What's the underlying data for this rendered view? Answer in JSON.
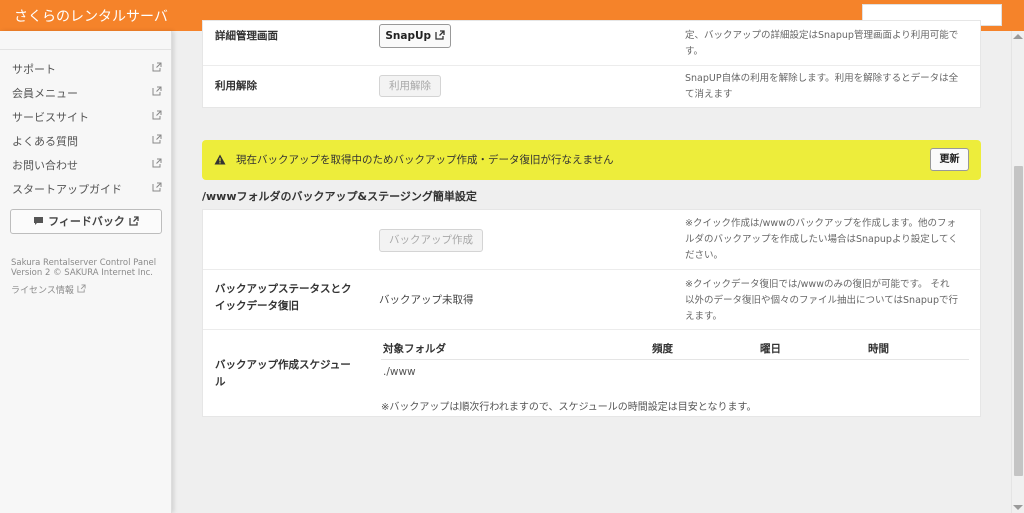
{
  "header": {
    "brand": "さくらのレンタルサーバ"
  },
  "sidebar": {
    "links": [
      {
        "label": "サポート",
        "icon": "external-link-icon"
      },
      {
        "label": "会員メニュー",
        "icon": "external-link-icon"
      },
      {
        "label": "サービスサイト",
        "icon": "external-link-icon"
      },
      {
        "label": "よくある質問",
        "icon": "external-link-icon"
      },
      {
        "label": "お問い合わせ",
        "icon": "external-link-icon"
      },
      {
        "label": "スタートアップガイド",
        "icon": "external-link-icon"
      }
    ],
    "feedback_label": "フィードバック",
    "footer_line1": "Sakura Rentalserver Control Panel",
    "footer_line2": "Version 2 © SAKURA Internet Inc.",
    "license": "ライセンス情報"
  },
  "snapup_panel": {
    "detail_label": "詳細管理画面",
    "snapup_button": "SnapUp",
    "detail_desc_1": "定、バックアップの詳細設定はSnapup管理画面より利用可能で",
    "detail_desc_2": "す。",
    "cancel_label": "利用解除",
    "cancel_button": "利用解除",
    "cancel_desc_1": "SnapUP自体の利用を解除します。利用を解除するとデータは全",
    "cancel_desc_2": "て消えます"
  },
  "alert": {
    "message": "現在バックアップを取得中のためバックアップ作成・データ復旧が行なえません",
    "refresh_button": "更新",
    "color": "#eded3b"
  },
  "section_title": "/wwwフォルダのバックアップ&ステージング簡単設定",
  "backup_panel": {
    "create_button": "バックアップ作成",
    "create_desc_1": "※クイック作成は/wwwのバックアップを作成します。他のフォ",
    "create_desc_2": "ルダのバックアップを作成したい場合はSnapupより設定してく",
    "create_desc_3": "ださい。",
    "status_label_1": "バックアップステータスとク",
    "status_label_2": "イックデータ復旧",
    "status_value": "バックアップ未取得",
    "status_desc_1": "※クイックデータ復旧では/wwwのみの復旧が可能です。 それ",
    "status_desc_2": "以外のデータ復旧や個々のファイル抽出についてはSnapupで行",
    "status_desc_3": "えます。",
    "schedule_label_1": "バックアップ作成スケジュー",
    "schedule_label_2": "ル",
    "schedule": {
      "headers": [
        "対象フォルダ",
        "頻度",
        "曜日",
        "時間"
      ],
      "rows": [
        [
          "./www",
          "",
          "",
          ""
        ]
      ],
      "note": "※バックアップは順次行われますので、スケジュールの時間設定は目安となります。"
    }
  },
  "colors": {
    "header": "#f5832a",
    "alert": "#eded3b"
  }
}
